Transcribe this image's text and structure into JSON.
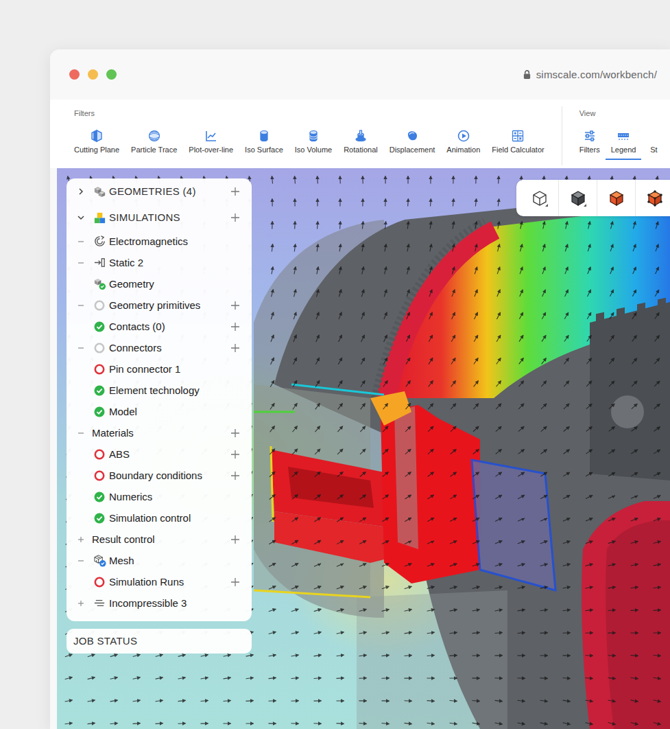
{
  "window": {
    "url": "simscale.com/workbench/"
  },
  "toolbar": {
    "groups": [
      {
        "label": "Filters",
        "buttons": [
          {
            "label": "Cutting Plane",
            "icon": "cutting-plane",
            "selected": false
          },
          {
            "label": "Particle Trace",
            "icon": "particle-trace",
            "selected": false
          },
          {
            "label": "Plot-over-line",
            "icon": "plot-over-line",
            "selected": false
          },
          {
            "label": "Iso Surface",
            "icon": "iso-surface",
            "selected": false
          },
          {
            "label": "Iso Volume",
            "icon": "iso-volume",
            "selected": false
          },
          {
            "label": "Rotational",
            "icon": "rotational",
            "selected": false
          },
          {
            "label": "Displacement",
            "icon": "displacement",
            "selected": false
          },
          {
            "label": "Animation",
            "icon": "animation",
            "selected": false
          },
          {
            "label": "Field Calculator",
            "icon": "field-calculator",
            "selected": false
          }
        ]
      },
      {
        "label": "View",
        "buttons": [
          {
            "label": "Filters",
            "icon": "sliders",
            "selected": false
          },
          {
            "label": "Legend",
            "icon": "legend",
            "selected": true
          },
          {
            "label": "St",
            "icon": "none",
            "selected": false
          }
        ]
      }
    ]
  },
  "view_cube": {
    "buttons": [
      {
        "kind": "outline",
        "menu": true
      },
      {
        "kind": "solid",
        "menu": true
      },
      {
        "kind": "orange",
        "menu": false
      },
      {
        "kind": "orange-points",
        "menu": false
      }
    ]
  },
  "tree": {
    "headers": [
      {
        "label": "GEOMETRIES (4)",
        "expanded": false,
        "icon": "geometries",
        "addable": true
      },
      {
        "label": "SIMULATIONS",
        "expanded": true,
        "icon": "simulations",
        "addable": true
      }
    ],
    "items": [
      {
        "label": "Electromagnetics",
        "toggle": true,
        "expanded": true,
        "icon": "electromagnetics",
        "status": "none",
        "addable": false
      },
      {
        "label": "Static 2",
        "toggle": true,
        "expanded": true,
        "icon": "static",
        "status": "none",
        "addable": false
      },
      {
        "label": "Geometry",
        "toggle": false,
        "expanded": false,
        "icon": "geometry",
        "status": "none",
        "addable": false
      },
      {
        "label": "Geometry primitives",
        "toggle": true,
        "expanded": true,
        "icon": "none",
        "status": "pending",
        "addable": true
      },
      {
        "label": "Contacts (0)",
        "toggle": false,
        "expanded": false,
        "icon": "none",
        "status": "ok",
        "addable": true
      },
      {
        "label": "Connectors",
        "toggle": true,
        "expanded": true,
        "icon": "none",
        "status": "pending",
        "addable": true
      },
      {
        "label": "Pin connector 1",
        "toggle": false,
        "expanded": false,
        "icon": "none",
        "status": "error",
        "addable": false
      },
      {
        "label": "Element technology",
        "toggle": false,
        "expanded": false,
        "icon": "none",
        "status": "ok",
        "addable": false
      },
      {
        "label": "Model",
        "toggle": false,
        "expanded": false,
        "icon": "none",
        "status": "ok",
        "addable": false
      },
      {
        "label": "Materials",
        "toggle": true,
        "expanded": true,
        "icon": "none",
        "status": "none",
        "addable": true
      },
      {
        "label": "ABS",
        "toggle": false,
        "expanded": false,
        "icon": "none",
        "status": "error",
        "addable": true
      },
      {
        "label": "Boundary conditions",
        "toggle": false,
        "expanded": false,
        "icon": "none",
        "status": "error",
        "addable": true
      },
      {
        "label": "Numerics",
        "toggle": false,
        "expanded": false,
        "icon": "none",
        "status": "ok",
        "addable": false
      },
      {
        "label": "Simulation control",
        "toggle": false,
        "expanded": false,
        "icon": "none",
        "status": "ok",
        "addable": false
      },
      {
        "label": "Result control",
        "toggle": true,
        "expanded": false,
        "icon": "none",
        "status": "none",
        "addable": true
      },
      {
        "label": "Mesh",
        "toggle": true,
        "expanded": true,
        "icon": "mesh",
        "status": "none",
        "addable": false
      },
      {
        "label": "Simulation Runs",
        "toggle": false,
        "expanded": false,
        "icon": "none",
        "status": "error",
        "addable": true
      },
      {
        "label": "Incompressible 3",
        "toggle": true,
        "expanded": false,
        "icon": "incompressible",
        "status": "none",
        "addable": false
      }
    ]
  },
  "job_status": {
    "label": "JOB STATUS"
  }
}
